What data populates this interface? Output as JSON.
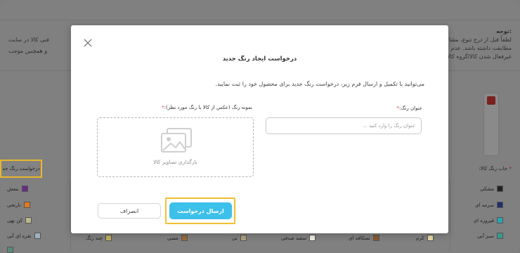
{
  "background": {
    "note_left_1": "توجه:",
    "note_left_2": "لطفاً قبل از درج تنوع، مشا",
    "note_left_3": "مطابقت داشته باشد. عدم",
    "note_left_4": "غیرفعال شدن کالا/گروه کالا",
    "note_right_2": "فنی کالا در سایت",
    "note_right_3": "و همچنین موجب",
    "section_label": "جاب رنگ کالا:",
    "section_req": "*",
    "request_color_label": "درخواست رنگ جد",
    "colors_left": [
      {
        "label": "بنفش",
        "color": "#6a2a85"
      },
      {
        "label": "نارنجی",
        "color": "#e07a1f"
      },
      {
        "label": "کن بهی",
        "color": "#b8b98a"
      },
      {
        "label": "نقره ای آبی",
        "color": "#9fb0c0"
      },
      {
        "label": "",
        "color": "#5a8a7a"
      }
    ],
    "colors_right": [
      {
        "label": "مشکی",
        "color": "#222222"
      },
      {
        "label": "سرمه ای",
        "color": "#1f2f6b"
      },
      {
        "label": "فیروزه ای",
        "color": "#2aa6b0"
      },
      {
        "label": "سبز آبی",
        "color": "#3a9a8a"
      }
    ],
    "colors_bottom": [
      {
        "label": "چند رنگ",
        "color": "#c0b060"
      },
      {
        "label": "مسی",
        "color": "#9a6a3a"
      },
      {
        "label": "نی",
        "color": "#b0a080"
      },
      {
        "label": "سفید صدفی",
        "color": "#f0ece0"
      },
      {
        "label": "نسکافه ای",
        "color": "#8a5a30"
      },
      {
        "label": "کرم",
        "color": "#e8d8a0"
      }
    ]
  },
  "modal": {
    "title": "درخواست ایجاد رنگ جدید",
    "description": "می‌توانید با تکمیل و ارسال فرم زیر، درخواست رنگ جدید برای محصول خود را ثبت نمایید.",
    "name_label": "عنوان رنگ:",
    "name_required": "*",
    "name_placeholder": "عنوان رنگ را وارد کنید ...",
    "name_value": "",
    "image_label": "نمونه رنگ (عکس از کالا با رنگ مورد نظر):",
    "image_required": "*",
    "upload_text": "بارگذاری تصاویر کالا",
    "submit_label": "ارسال درخواست",
    "cancel_label": "انصراف",
    "close_icon": "close-icon",
    "upload_icon": "image-gallery-icon",
    "accent_color": "#3dc0ea",
    "required_color": "#e53935",
    "highlight_color": "#f0c030"
  }
}
